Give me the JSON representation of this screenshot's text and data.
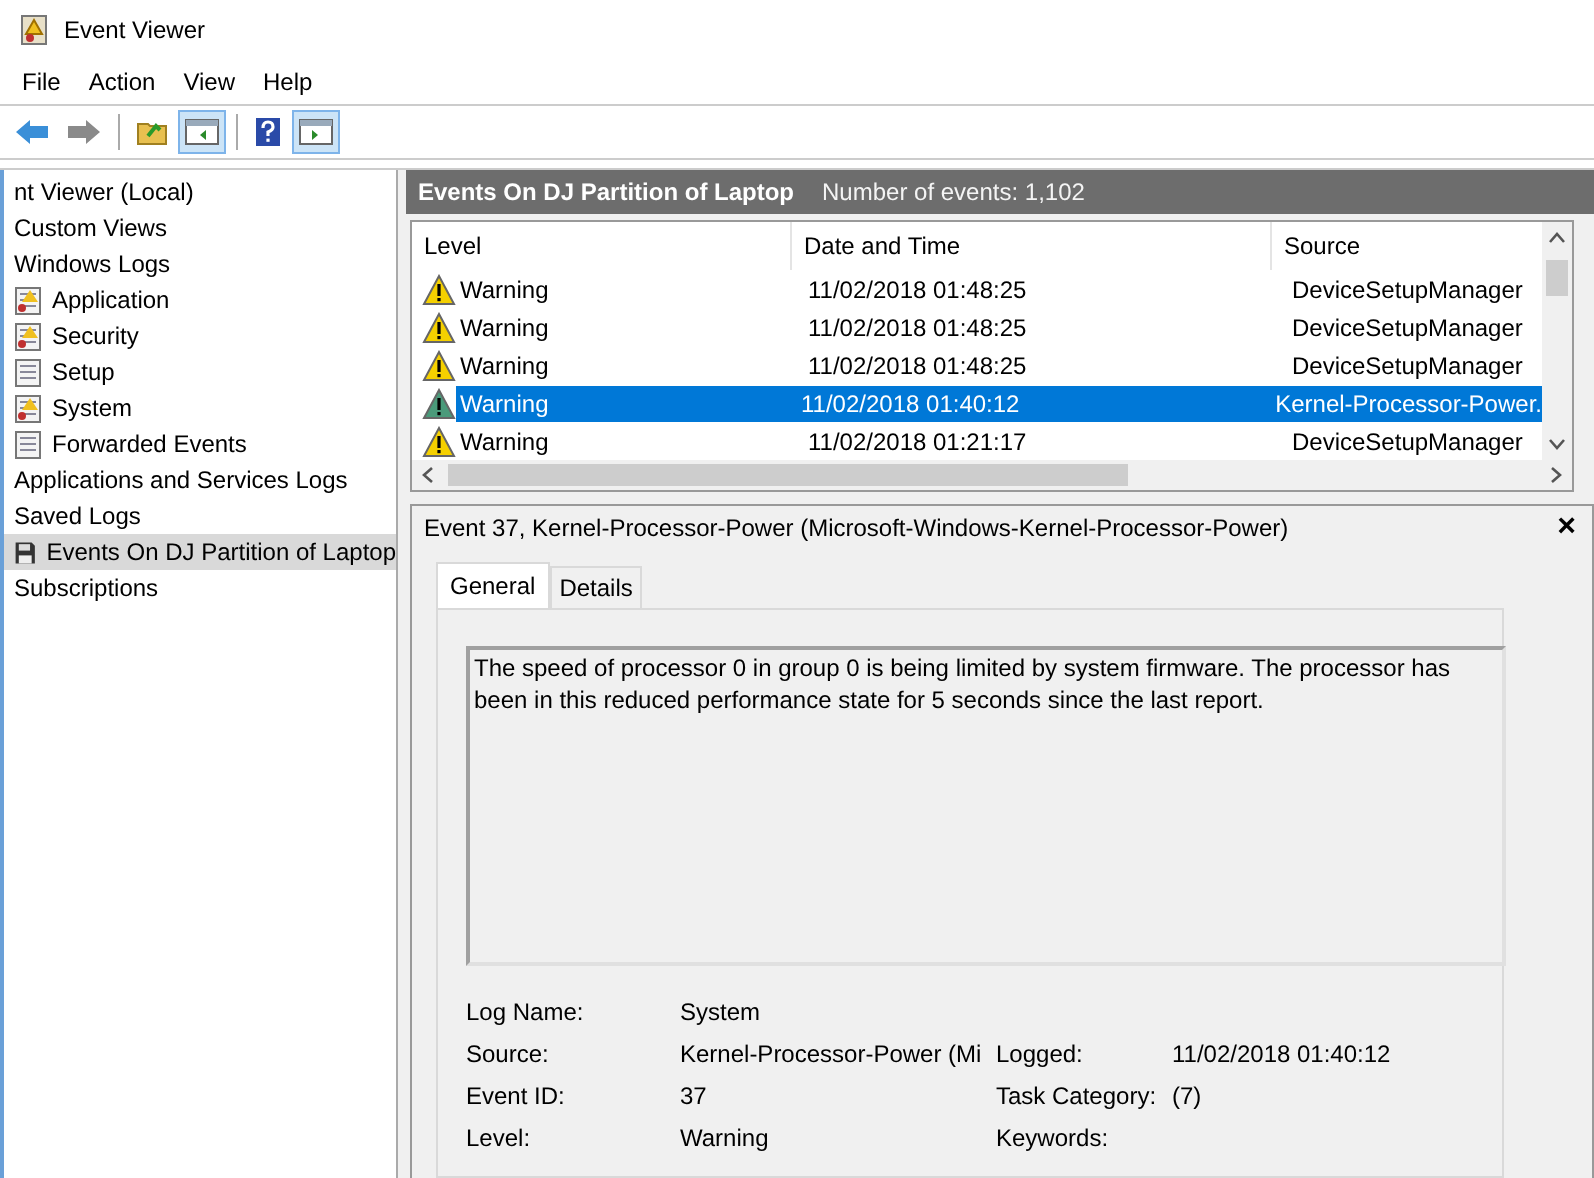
{
  "window": {
    "title": "Event Viewer"
  },
  "menu": [
    "File",
    "Action",
    "View",
    "Help"
  ],
  "toolbar": [
    {
      "kind": "back",
      "selected": false
    },
    {
      "kind": "forward",
      "selected": false
    },
    {
      "kind": "folder",
      "selected": false
    },
    {
      "kind": "pane-left",
      "selected": true
    },
    {
      "kind": "help",
      "selected": false
    },
    {
      "kind": "pane-right",
      "selected": true
    }
  ],
  "tree": [
    {
      "label": "nt Viewer (Local)",
      "selected": false,
      "children": [
        {
          "label": "Custom Views",
          "selected": false
        },
        {
          "label": "Windows Logs",
          "selected": false,
          "children": [
            {
              "label": "Application",
              "kind": "warnlog",
              "selected": false
            },
            {
              "label": "Security",
              "kind": "warnlog",
              "selected": false
            },
            {
              "label": "Setup",
              "kind": "log",
              "selected": false
            },
            {
              "label": "System",
              "kind": "warnlog",
              "selected": false
            },
            {
              "label": "Forwarded Events",
              "kind": "log",
              "selected": false
            }
          ]
        },
        {
          "label": "Applications and Services Logs",
          "selected": false
        },
        {
          "label": "Saved Logs",
          "selected": false,
          "children": [
            {
              "label": "Events On DJ Partition of Laptop",
              "kind": "saved",
              "selected": true
            }
          ]
        },
        {
          "label": "Subscriptions",
          "selected": false
        }
      ]
    }
  ],
  "header": {
    "title": "Events On DJ Partition of Laptop",
    "count": "Number of events: 1,102"
  },
  "table": {
    "columns": [
      "Level",
      "Date and Time",
      "Source"
    ],
    "rows": [
      {
        "level": "Warning",
        "date": "11/02/2018 01:48:25",
        "source": "DeviceSetupManager",
        "selected": false
      },
      {
        "level": "Warning",
        "date": "11/02/2018 01:48:25",
        "source": "DeviceSetupManager",
        "selected": false
      },
      {
        "level": "Warning",
        "date": "11/02/2018 01:48:25",
        "source": "DeviceSetupManager",
        "selected": false
      },
      {
        "level": "Warning",
        "date": "11/02/2018 01:40:12",
        "source": "Kernel-Processor-Power.",
        "selected": true
      },
      {
        "level": "Warning",
        "date": "11/02/2018 01:21:17",
        "source": "DeviceSetupManager",
        "selected": false
      }
    ]
  },
  "detail": {
    "title": "Event 37, Kernel-Processor-Power (Microsoft-Windows-Kernel-Processor-Power)",
    "close": "×",
    "tabs": [
      {
        "label": "General",
        "selected": true
      },
      {
        "label": "Details",
        "selected": false
      }
    ],
    "message": "The speed of processor 0 in group 0 is being limited by system firmware. The processor has been in this reduced performance state for 5 seconds since the last report.",
    "fields": [
      {
        "label": "Log Name:",
        "value": "System"
      },
      {
        "label": "Source:",
        "value": "Kernel-Processor-Power (Mi",
        "label2": "Logged:",
        "value2": "11/02/2018 01:40:12"
      },
      {
        "label": "Event ID:",
        "value": "37",
        "label2": "Task Category:",
        "value2": "(7)"
      },
      {
        "label": "Level:",
        "value": "Warning",
        "label2": "Keywords:"
      }
    ]
  }
}
